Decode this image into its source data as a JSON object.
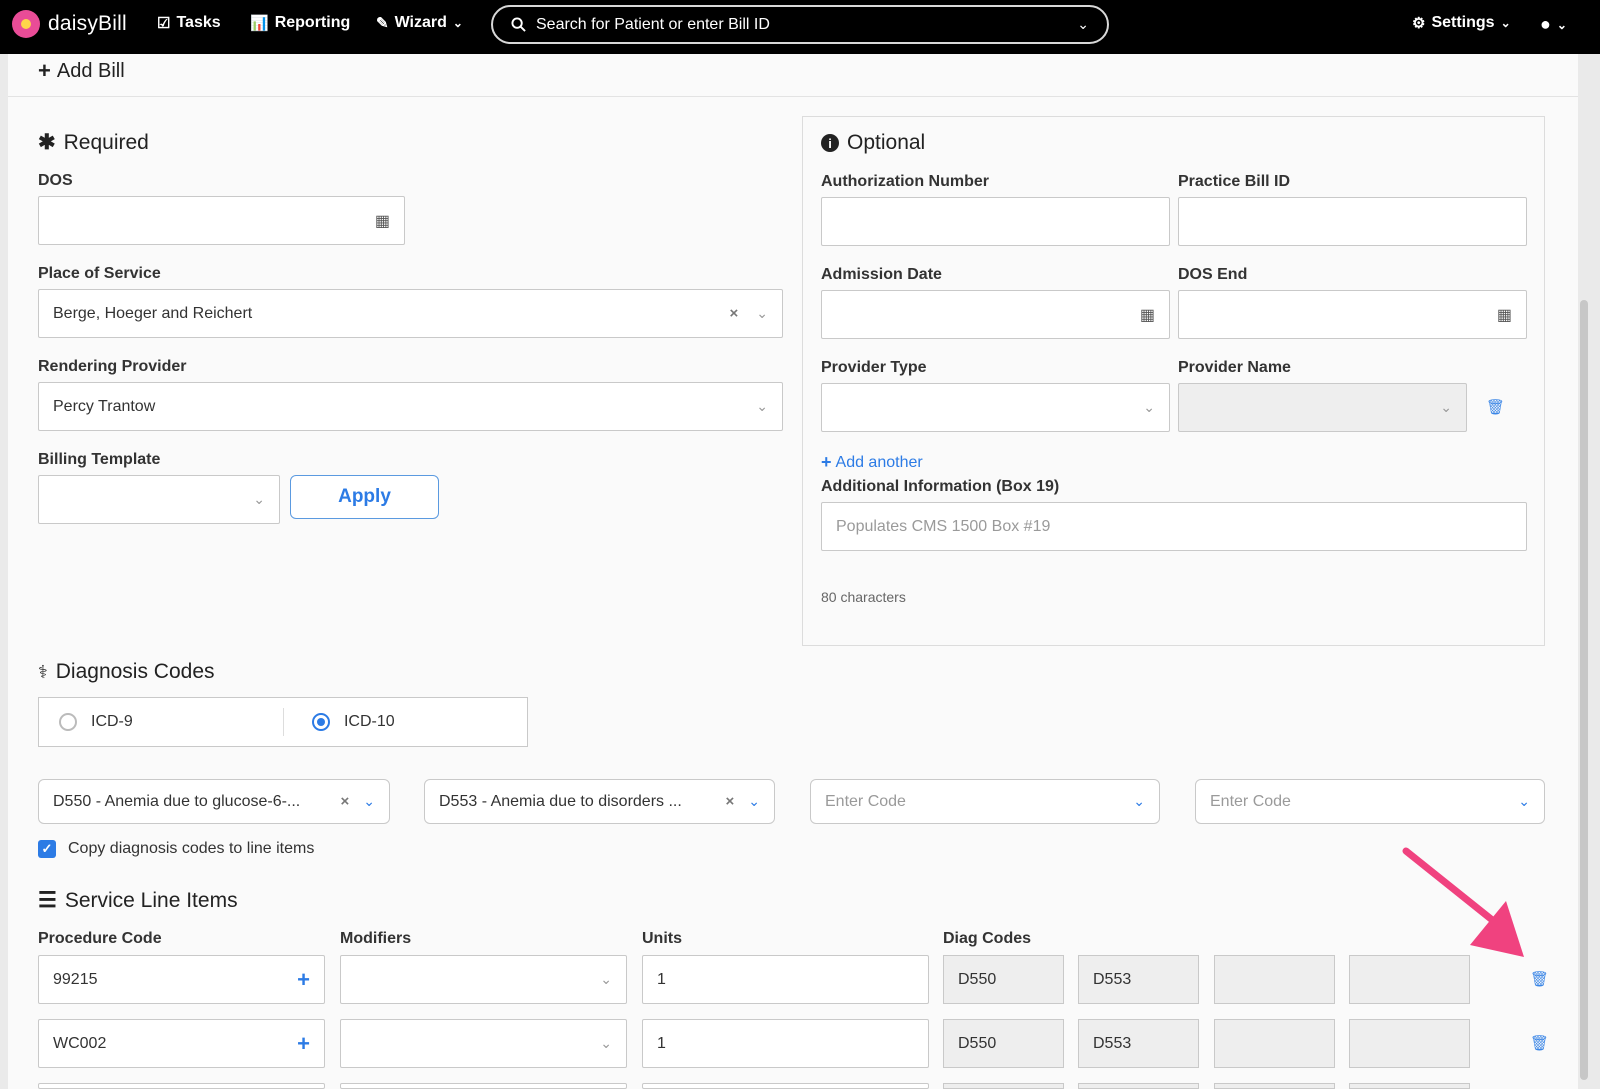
{
  "nav": {
    "brand": "daisyBill",
    "tasks": "Tasks",
    "reporting": "Reporting",
    "wizard": "Wizard",
    "search_placeholder": "Search for Patient or enter Bill ID",
    "settings": "Settings"
  },
  "page": {
    "title": "Add Bill"
  },
  "required": {
    "title": "Required",
    "dos_label": "DOS",
    "place_label": "Place of Service",
    "place_value": "Berge, Hoeger and Reichert",
    "provider_label": "Rendering Provider",
    "provider_value": "Percy Trantow",
    "template_label": "Billing Template",
    "apply_label": "Apply"
  },
  "optional": {
    "title": "Optional",
    "auth_label": "Authorization Number",
    "practice_id_label": "Practice Bill ID",
    "admission_label": "Admission Date",
    "dos_end_label": "DOS End",
    "provider_type_label": "Provider Type",
    "provider_name_label": "Provider Name",
    "add_another": "Add another",
    "additional_label": "Additional Information (Box 19)",
    "additional_placeholder": "Populates CMS 1500 Box #19",
    "chars": "80 characters"
  },
  "diagnosis": {
    "title": "Diagnosis Codes",
    "icd9": "ICD-9",
    "icd10": "ICD-10",
    "selected_system": "ICD-10",
    "code1": "D550 - Anemia due to glucose-6-...",
    "code2": "D553 - Anemia due to disorders ...",
    "code3_placeholder": "Enter Code",
    "code4_placeholder": "Enter Code",
    "copy_label": "Copy diagnosis codes to line items",
    "copy_checked": true
  },
  "service": {
    "title": "Service Line Items",
    "col_procedure": "Procedure Code",
    "col_modifiers": "Modifiers",
    "col_units": "Units",
    "col_diag": "Diag Codes",
    "rows": [
      {
        "procedure": "99215",
        "units": "1",
        "diag1": "D550",
        "diag2": "D553"
      },
      {
        "procedure": "WC002",
        "units": "1",
        "diag1": "D550",
        "diag2": "D553"
      }
    ]
  },
  "colors": {
    "accent": "#2c7be5",
    "arrow": "#f0427f",
    "topbar": "#000000"
  }
}
